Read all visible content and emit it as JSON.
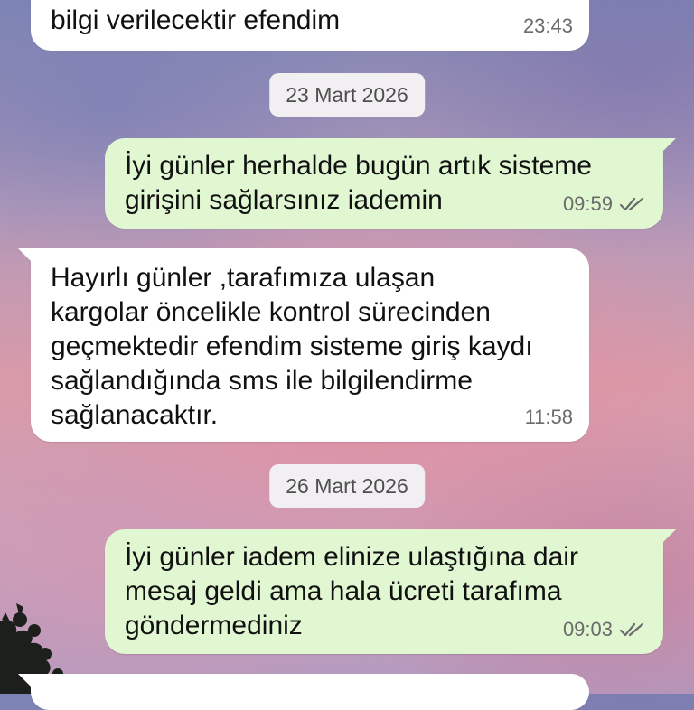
{
  "messages": [
    {
      "id": "m1",
      "direction": "incoming",
      "text": "bilgi verilecektir efendim",
      "time": "23:43"
    },
    {
      "id": "m2",
      "direction": "outgoing",
      "text": "İyi günler herhalde bugün artık sisteme\ngirişini sağlarsınız iademin",
      "time": "09:59",
      "status_icon": "double-check-icon"
    },
    {
      "id": "m3",
      "direction": "incoming",
      "text": "Hayırlı günler ,tarafımıza ulaşan\nkargolar öncelikle kontrol sürecinden\ngeçmektedir efendim sisteme giriş kaydı\nsağlandığında sms ile bilgilendirme\nsağlanacaktır.",
      "time": "11:58"
    },
    {
      "id": "m4",
      "direction": "outgoing",
      "text": "İyi günler iadem elinize ulaştığına dair\nmesaj geldi ama hala ücreti tarafıma\ngöndermediniz",
      "time": "09:03",
      "status_icon": "double-check-icon"
    }
  ],
  "date_separators": [
    "23 Mart 2026",
    "26 Mart 2026"
  ],
  "colors": {
    "incoming": "#ffffff",
    "outgoing": "#e1f7d2",
    "ticks": "#6b6b6b"
  }
}
